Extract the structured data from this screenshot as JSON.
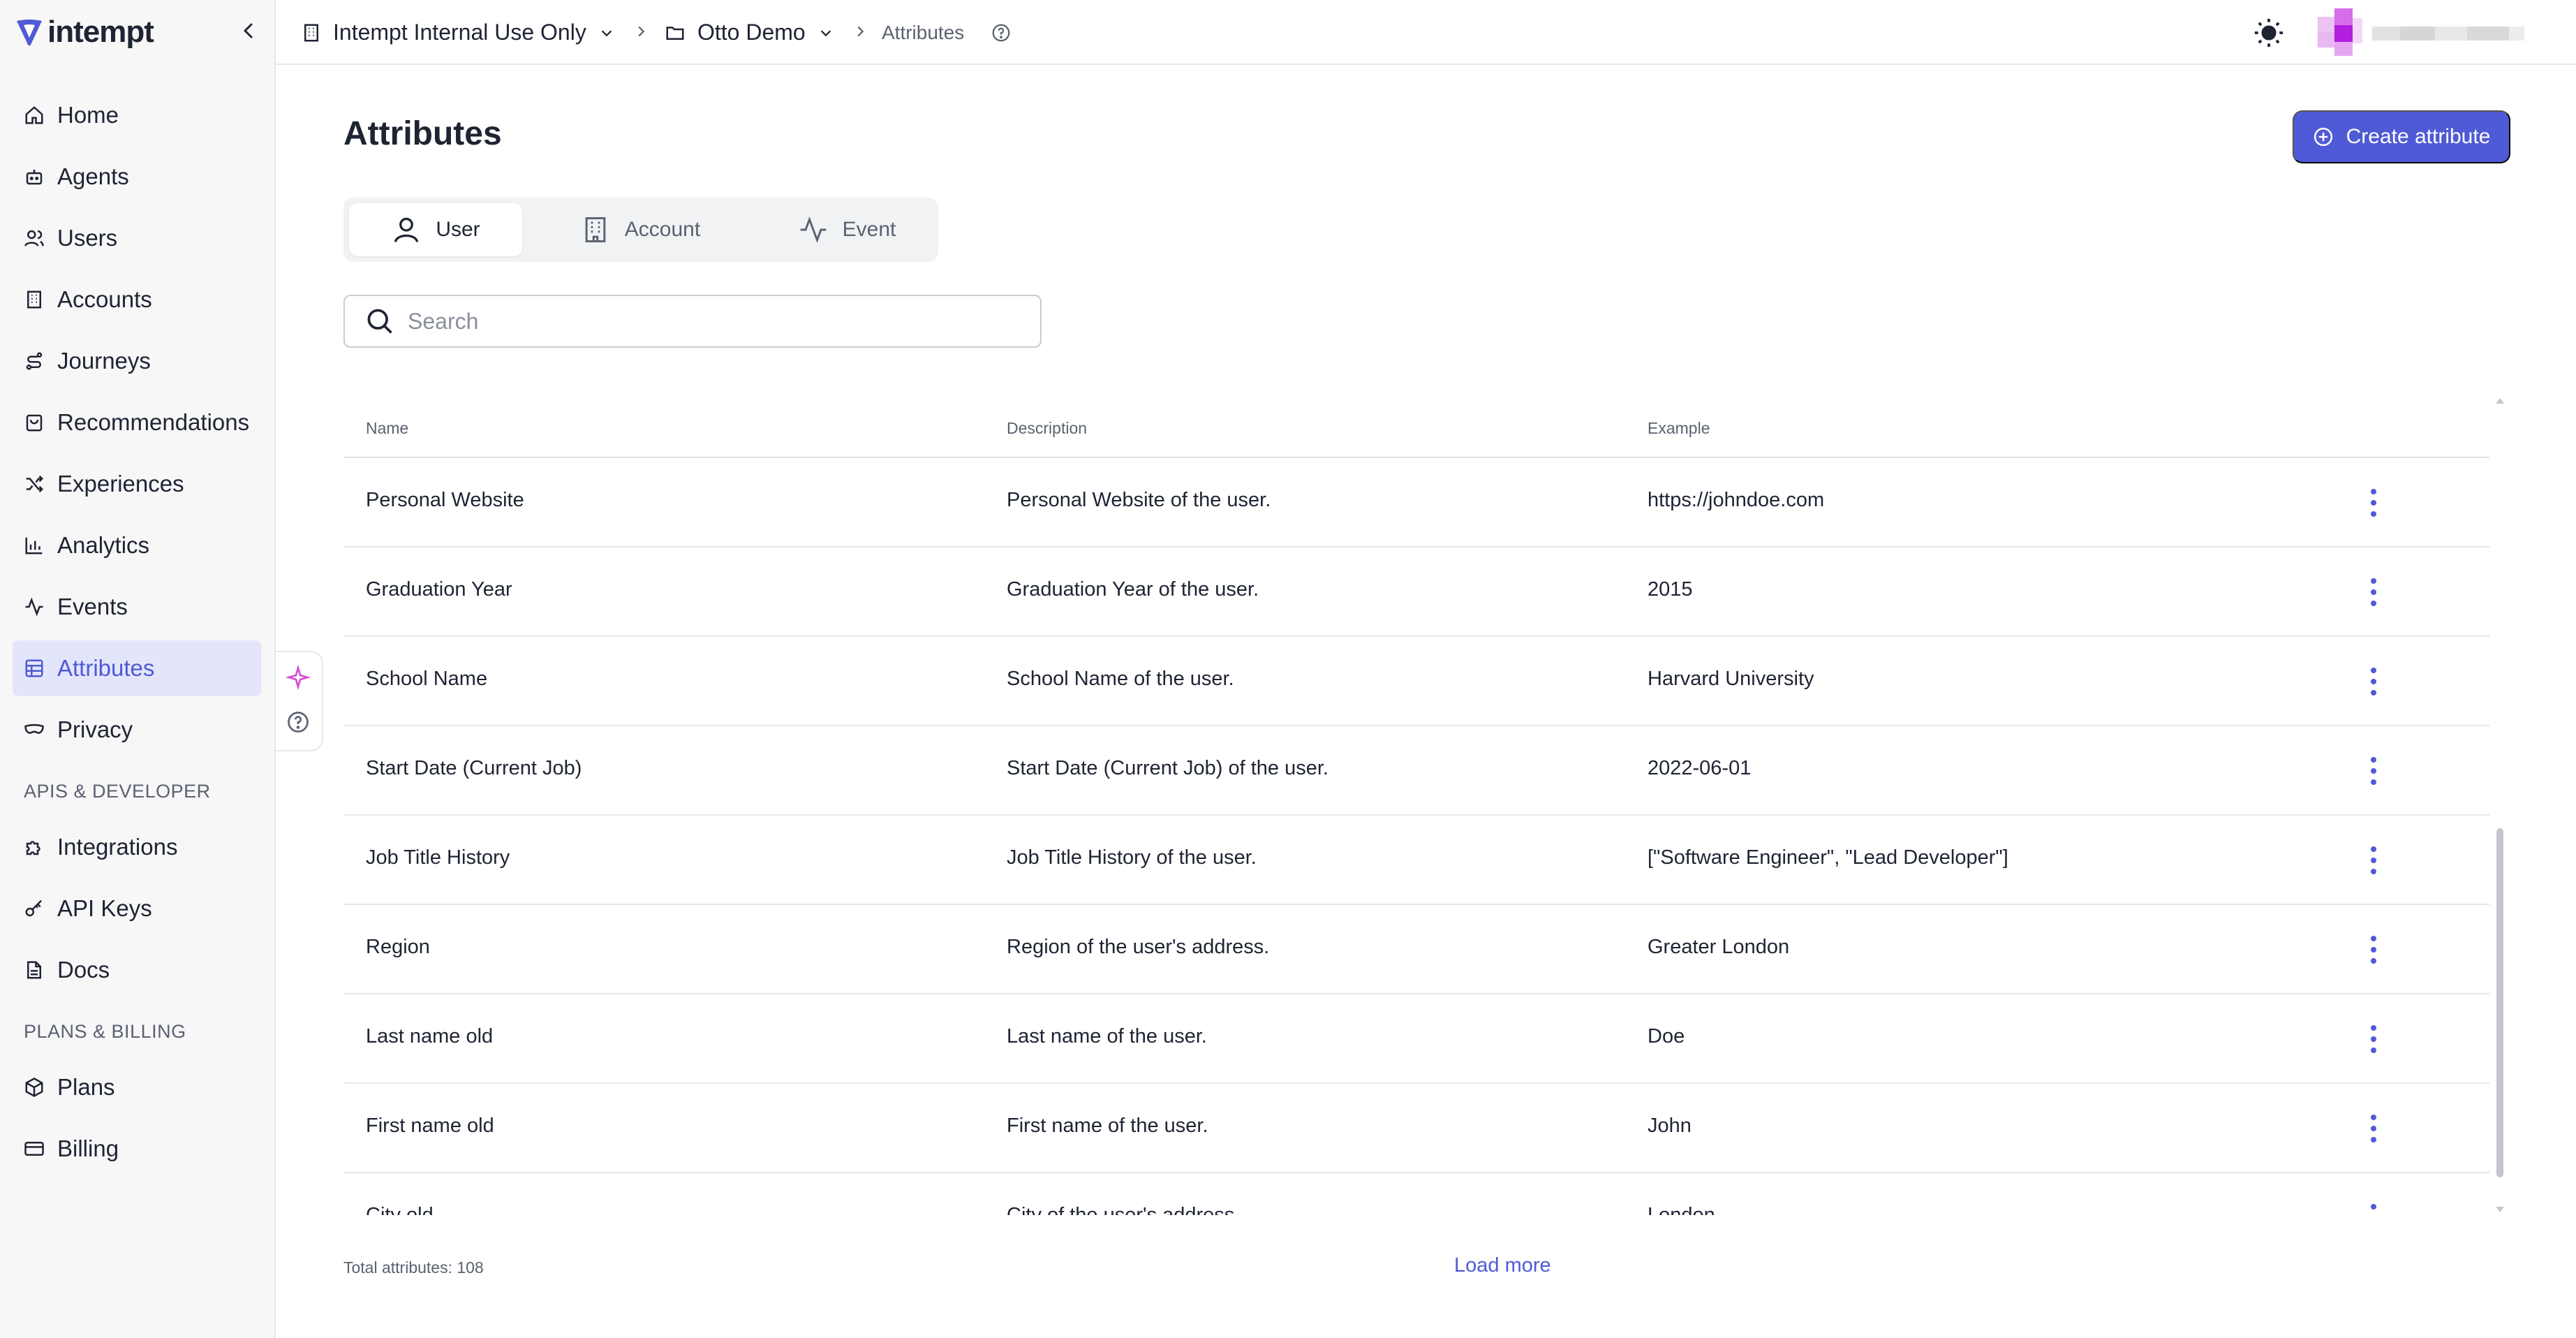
{
  "app": {
    "name": "intempt"
  },
  "sidebar": {
    "items": [
      {
        "label": "Home",
        "icon": "home-icon"
      },
      {
        "label": "Agents",
        "icon": "bot-icon"
      },
      {
        "label": "Users",
        "icon": "users-icon"
      },
      {
        "label": "Accounts",
        "icon": "building-icon"
      },
      {
        "label": "Journeys",
        "icon": "route-icon"
      },
      {
        "label": "Recommendations",
        "icon": "bag-icon"
      },
      {
        "label": "Experiences",
        "icon": "shuffle-icon"
      },
      {
        "label": "Analytics",
        "icon": "bar-chart-icon"
      },
      {
        "label": "Events",
        "icon": "activity-icon"
      },
      {
        "label": "Attributes",
        "icon": "table-icon",
        "active": true
      },
      {
        "label": "Privacy",
        "icon": "mask-icon"
      }
    ],
    "section_dev": "APIS & DEVELOPER",
    "dev_items": [
      {
        "label": "Integrations",
        "icon": "puzzle-icon"
      },
      {
        "label": "API Keys",
        "icon": "key-icon"
      },
      {
        "label": "Docs",
        "icon": "document-icon"
      }
    ],
    "section_billing": "PLANS & BILLING",
    "billing_items": [
      {
        "label": "Plans",
        "icon": "package-icon"
      },
      {
        "label": "Billing",
        "icon": "credit-card-icon"
      }
    ]
  },
  "breadcrumb": {
    "organization": "Intempt Internal Use Only",
    "project": "Otto Demo",
    "page": "Attributes"
  },
  "page": {
    "title": "Attributes",
    "create_button": "Create attribute"
  },
  "type_tabs": [
    {
      "label": "User",
      "icon": "user-icon",
      "active": true
    },
    {
      "label": "Account",
      "icon": "building-icon",
      "active": false
    },
    {
      "label": "Event",
      "icon": "activity-icon",
      "active": false
    }
  ],
  "search": {
    "placeholder": "Search",
    "value": ""
  },
  "table": {
    "columns": [
      "Name",
      "Description",
      "Example"
    ],
    "rows": [
      {
        "name": "Personal Website",
        "description": "Personal Website of the user.",
        "example": "https://johndoe.com"
      },
      {
        "name": "Graduation Year",
        "description": "Graduation Year of the user.",
        "example": "2015"
      },
      {
        "name": "School Name",
        "description": "School Name of the user.",
        "example": "Harvard University"
      },
      {
        "name": "Start Date (Current Job)",
        "description": "Start Date (Current Job) of the user.",
        "example": "2022-06-01"
      },
      {
        "name": "Job Title History",
        "description": "Job Title History of the user.",
        "example": "[\"Software Engineer\", \"Lead Developer\"]"
      },
      {
        "name": "Region",
        "description": "Region of the user's address.",
        "example": "Greater London"
      },
      {
        "name": "Last name old",
        "description": "Last name of the user.",
        "example": "Doe"
      },
      {
        "name": "First name old",
        "description": "First name of the user.",
        "example": "John"
      },
      {
        "name": "City old",
        "description": "City of the user's address.",
        "example": "London"
      }
    ]
  },
  "footer": {
    "total": "Total attributes: 108",
    "load_more": "Load more"
  },
  "colors": {
    "accent": "#4f5ad6",
    "active_nav_bg": "#e3e6fb",
    "sidebar_bg": "#f7f7f8"
  }
}
